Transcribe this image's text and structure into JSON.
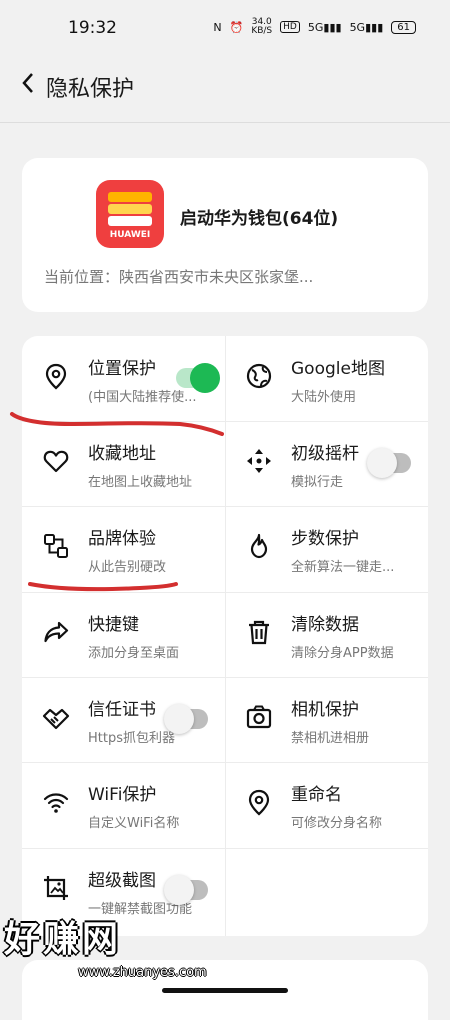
{
  "status": {
    "time": "19:32",
    "nfc": "N",
    "speed_value": "34.0",
    "speed_unit": "KB/S",
    "hd": "HD",
    "sig1": "5G",
    "sig2": "5G",
    "battery": "61"
  },
  "header": {
    "back_icon": "chevron-left-icon",
    "title": "隐私保护"
  },
  "app": {
    "name": "启动华为钱包(64位)",
    "icon_text": "HUAWEI",
    "location": "当前位置：陕西省西安市未央区张家堡..."
  },
  "tiles": [
    {
      "name": "位置保护",
      "sub": "(中国大陆推荐使...",
      "icon": "location-pin-icon",
      "toggle": "on"
    },
    {
      "name": "Google地图",
      "sub": "大陆外使用",
      "icon": "globe-icon"
    },
    {
      "name": "收藏地址",
      "sub": "在地图上收藏地址",
      "icon": "heart-icon"
    },
    {
      "name": "初级摇杆",
      "sub": "模拟行走",
      "icon": "move-arrows-icon",
      "toggle": "off"
    },
    {
      "name": "品牌体验",
      "sub": "从此告别硬改",
      "icon": "brand-icon"
    },
    {
      "name": "步数保护",
      "sub": "全新算法一键走...",
      "icon": "flame-icon"
    },
    {
      "name": "快捷键",
      "sub": "添加分身至桌面",
      "icon": "share-arrow-icon"
    },
    {
      "name": "清除数据",
      "sub": "清除分身APP数据",
      "icon": "trash-icon"
    },
    {
      "name": "信任证书",
      "sub": "Https抓包利器",
      "icon": "handshake-icon",
      "toggle": "off"
    },
    {
      "name": "相机保护",
      "sub": "禁相机进相册",
      "icon": "camera-icon"
    },
    {
      "name": "WiFi保护",
      "sub": "自定义WiFi名称",
      "icon": "wifi-icon"
    },
    {
      "name": "重命名",
      "sub": "可修改分身名称",
      "icon": "location-pin-icon"
    },
    {
      "name": "超级截图",
      "sub": "一键解禁截图功能",
      "icon": "screenshot-icon",
      "toggle": "off"
    }
  ],
  "watermark": {
    "text": "好赚网",
    "url": "www.zhuanyes.com"
  },
  "colors": {
    "accent_green": "#1db954",
    "annotation_red": "#d32f2f"
  }
}
